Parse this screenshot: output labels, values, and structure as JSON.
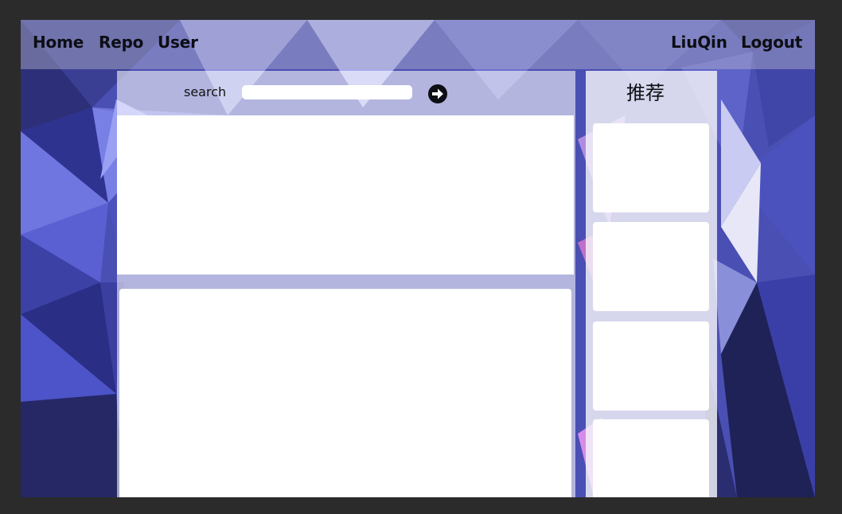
{
  "nav": {
    "home": "Home",
    "repo": "Repo",
    "user": "User",
    "username": "LiuQin",
    "logout": "Logout"
  },
  "search": {
    "label": "search",
    "value": "",
    "placeholder": "",
    "button_icon": "arrow-right-circle-icon"
  },
  "sidebar": {
    "title": "推荐",
    "cards_count": 4
  },
  "colors": {
    "page_background": "#2b2b2b",
    "navbar_overlay": "#b4b4cd",
    "text": "#0d0d14",
    "background_art": "low-poly blue-purple triangles"
  }
}
